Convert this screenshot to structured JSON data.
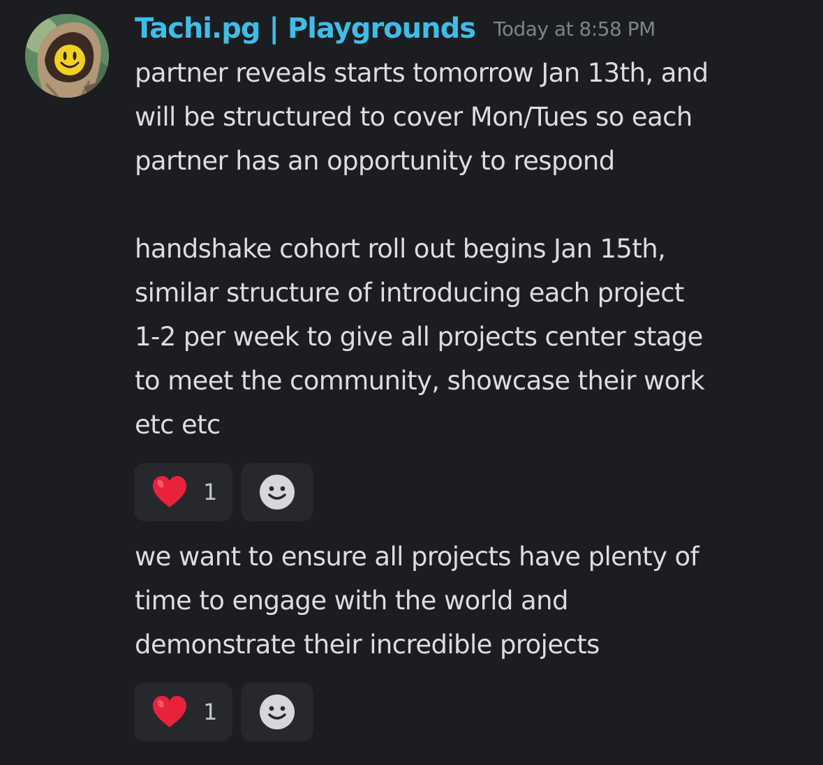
{
  "message": {
    "author": "Tachi.pg | Playgrounds",
    "timestamp": "Today at 8:58 PM",
    "avatar_icon": "hooded-cloak-yellow-face-avatar",
    "paragraphs": [
      {
        "text": "partner reveals starts tomorrow Jan 13th, and\nwill be structured to cover Mon/Tues so each\npartner has an opportunity to respond\n\nhandshake cohort roll out begins Jan 15th,\nsimilar structure of introducing each project\n1-2 per week to give all projects center stage\nto meet the community, showcase their work\netc etc",
        "reactions": [
          {
            "emoji": "heart-icon",
            "count": "1"
          },
          {
            "emoji": "add-reaction-smiley-icon",
            "count": ""
          }
        ]
      },
      {
        "text": "we want to ensure all projects have plenty of\ntime to engage with the world and\ndemonstrate their incredible projects",
        "reactions": [
          {
            "emoji": "heart-icon",
            "count": "1"
          },
          {
            "emoji": "add-reaction-smiley-icon",
            "count": ""
          }
        ]
      }
    ]
  },
  "colors": {
    "background": "#1c1d21",
    "username": "#3bbfe8",
    "timestamp": "#80838c",
    "text": "#dcdde1",
    "reaction_bg": "#27282d",
    "heart": "#e8223a"
  }
}
